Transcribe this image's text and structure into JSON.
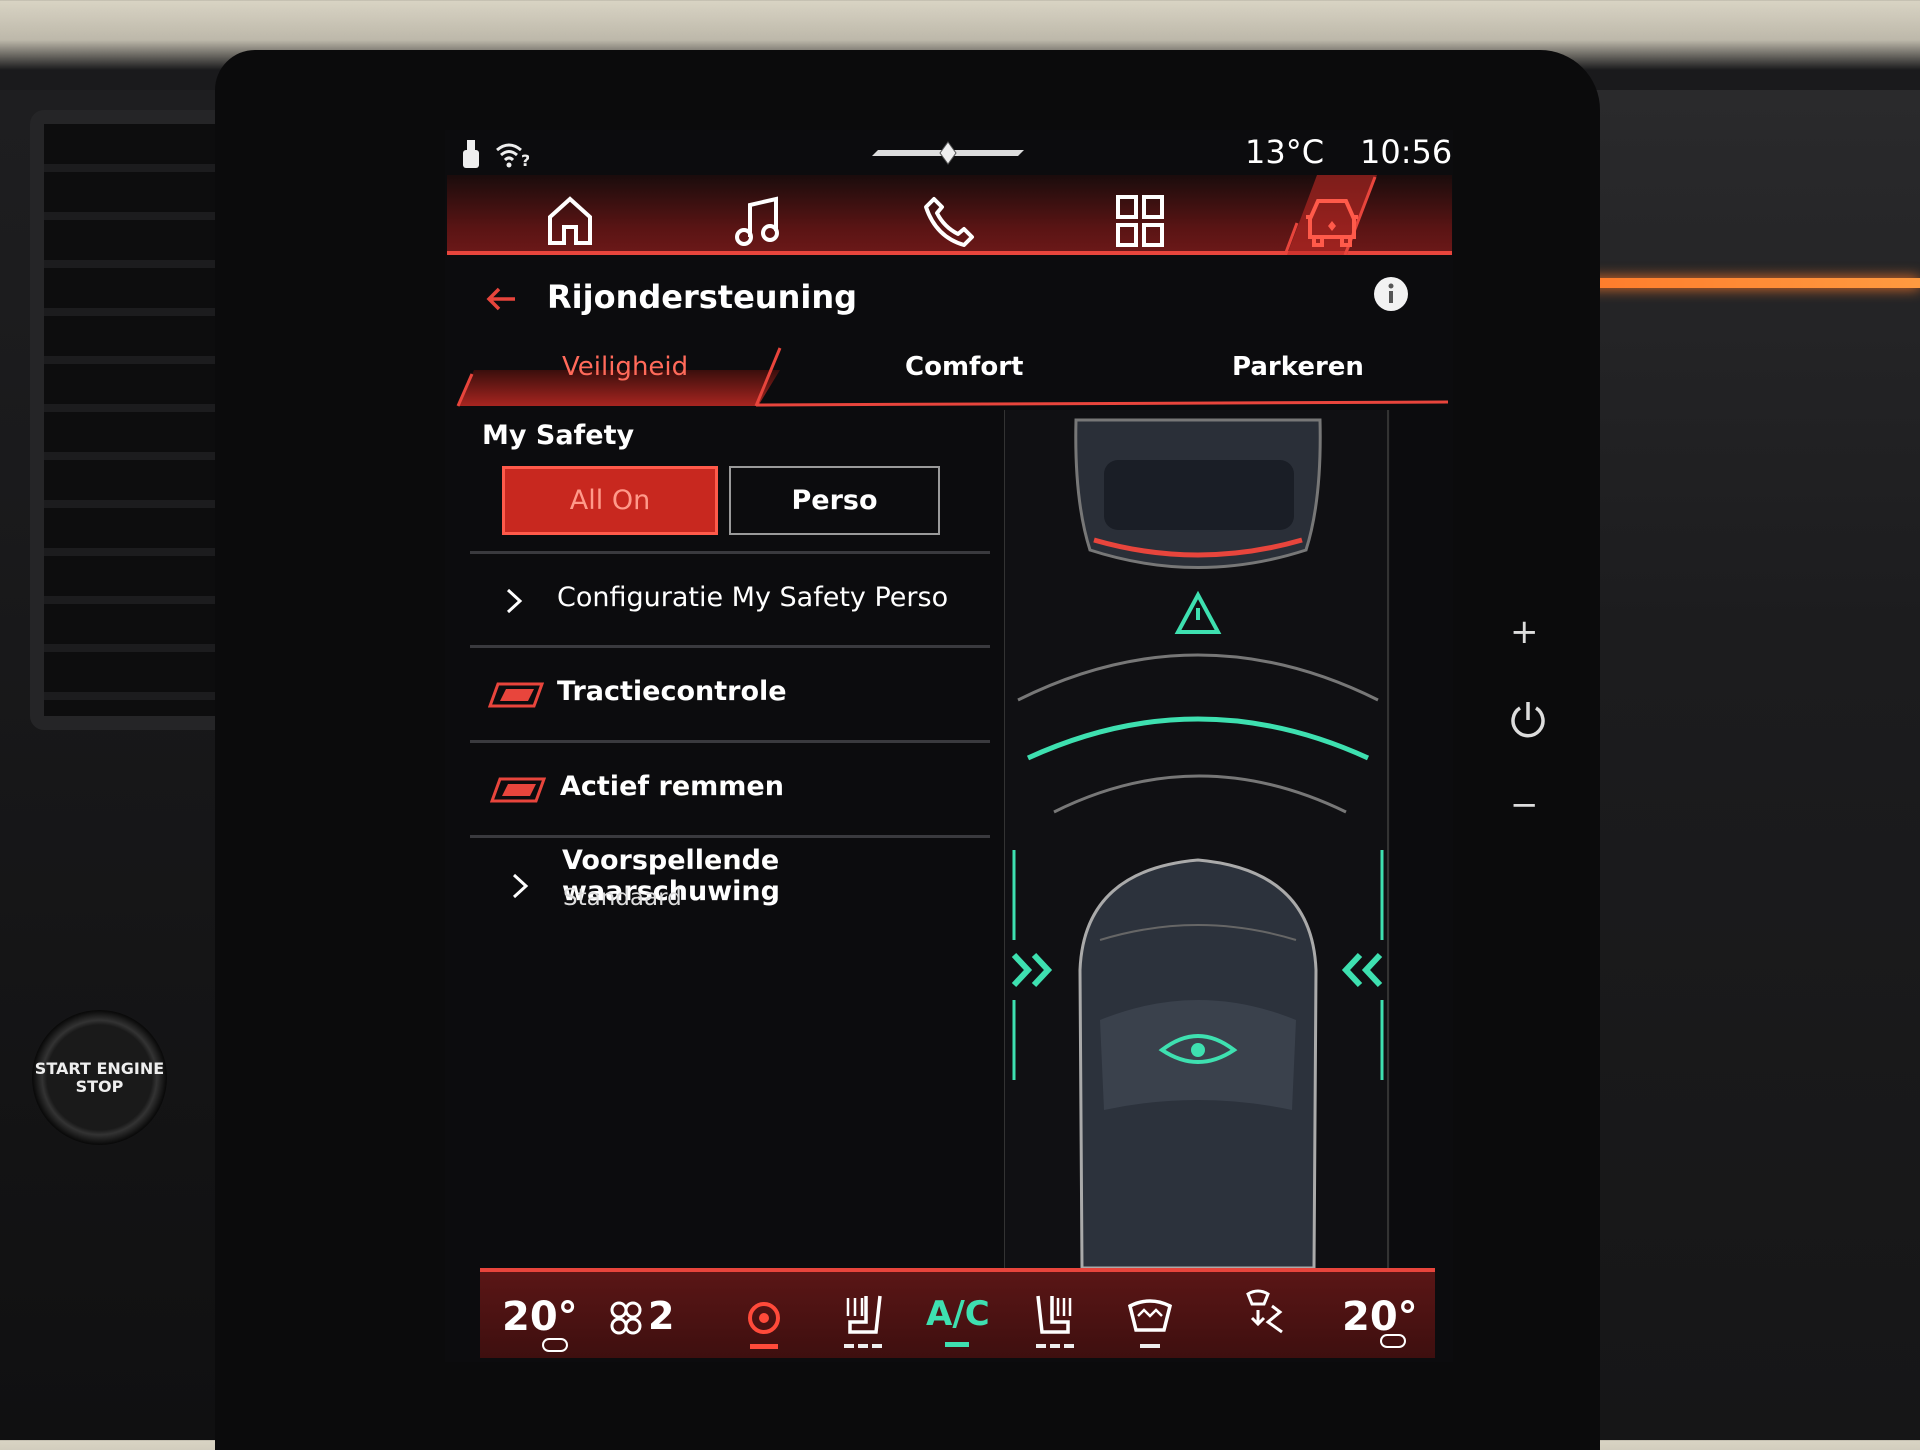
{
  "status_bar": {
    "temperature": "13°C",
    "time": "10:56",
    "icons": [
      "usb-icon",
      "wifi-question-icon",
      "brand-logo-icon"
    ]
  },
  "nav": {
    "items": [
      {
        "icon": "home-icon"
      },
      {
        "icon": "music-icon"
      },
      {
        "icon": "phone-icon"
      },
      {
        "icon": "apps-grid-icon"
      },
      {
        "icon": "car-icon",
        "active": true
      }
    ]
  },
  "header": {
    "title": "Rijondersteuning",
    "back_icon": "arrow-left-icon",
    "info_icon": "info-icon"
  },
  "tabs": [
    {
      "label": "Veiligheid",
      "active": true
    },
    {
      "label": "Comfort"
    },
    {
      "label": "Parkeren"
    }
  ],
  "my_safety": {
    "label": "My Safety",
    "options": [
      {
        "label": "All On",
        "selected": true
      },
      {
        "label": "Perso"
      }
    ]
  },
  "rows": [
    {
      "label": "Configuratie My Safety Perso",
      "type": "link"
    },
    {
      "label": "Tractiecontrole",
      "type": "toggle",
      "on": true
    },
    {
      "label": "Actief remmen",
      "type": "toggle",
      "on": true
    },
    {
      "label": "Voorspellende waarschuwing",
      "sublabel": "Standaard",
      "type": "link"
    }
  ],
  "side_controls": {
    "plus": "+",
    "minus": "−",
    "power_icon": "power-icon"
  },
  "climate": {
    "left_temp": "20°",
    "right_temp": "20°",
    "fan_speed": "2",
    "ac_label": "A/C"
  },
  "hardware": {
    "start_button": "START ENGINE STOP"
  },
  "colors": {
    "accent": "#e8453c",
    "teal": "#3ee0b0",
    "background": "#0c0c0e"
  }
}
